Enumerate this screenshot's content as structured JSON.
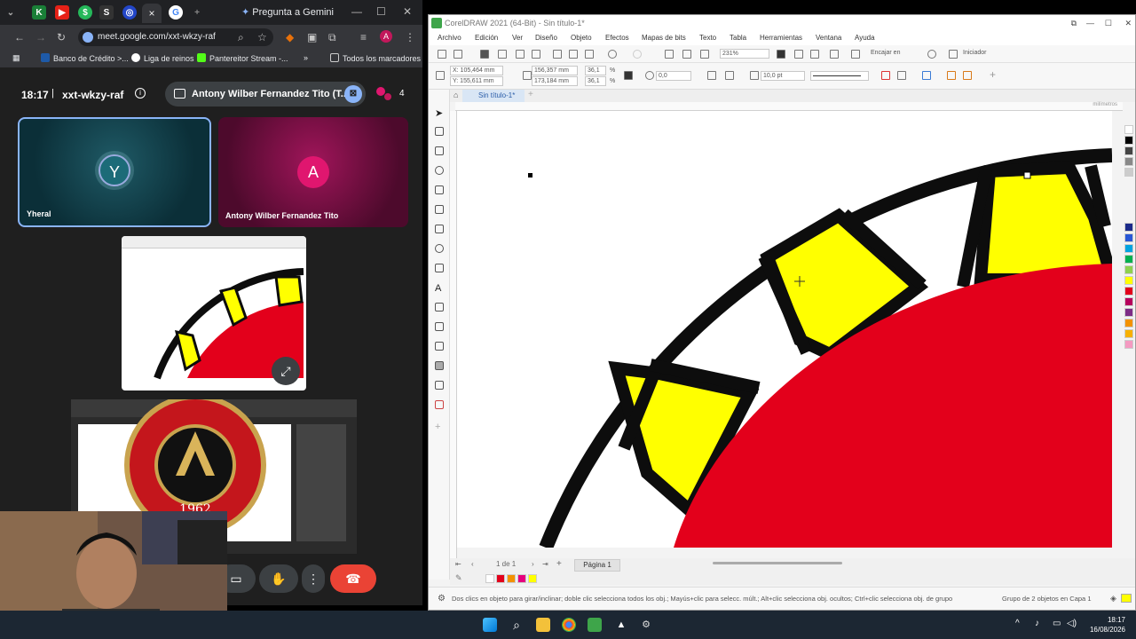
{
  "chrome": {
    "gemini_tab_title": "Pregunta a Gemini",
    "url": "meet.google.com/xxt-wkzy-raf",
    "bookmarks": [
      "Banco de Crédito >...",
      "Liga de reinos",
      "Pantereitor Stream -...",
      "»",
      "Todos los marcadores"
    ]
  },
  "meet": {
    "time": "18:17",
    "code": "xxt-wkzy-raf",
    "presenter_banner": "Antony Wilber Fernandez Tito (T...",
    "participant_count": "4",
    "tiles": [
      {
        "initial": "Y",
        "name": "Yheral",
        "color": "#1f5a66"
      },
      {
        "initial": "A",
        "name": "Antony Wilber Fernandez Tito",
        "color": "#e0166f"
      }
    ],
    "logo_text": "COLEGIO DE ... S DEL PERU",
    "logo_year": "1962"
  },
  "corel": {
    "title": "CorelDRAW 2021 (64-Bit) - Sin título-1*",
    "menu": [
      "Archivo",
      "Edición",
      "Ver",
      "Diseño",
      "Objeto",
      "Efectos",
      "Mapas de bits",
      "Texto",
      "Tabla",
      "Herramientas",
      "Ventana",
      "Ayuda"
    ],
    "zoom": "231%",
    "snap_label": "Encajar en",
    "launcher_label": "Iniciador",
    "x_pos": "X: 105,464 mm",
    "y_pos": "Y: 155,611 mm",
    "width": "156,357 mm",
    "height": "173,184 mm",
    "scale_x": "36,1",
    "scale_y": "36,1",
    "percent": "%",
    "rotation": "0,0",
    "outline": "10,0 pt",
    "doc_tab": "Sin título-1*",
    "ruler_unit": "milímetros",
    "page_count": "1 de 1",
    "page_tab": "Página 1",
    "status_hint": "Dos clics en objeto para girar/inclinar; doble clic selecciona todos los obj.; Mayús+clic para selecc. múlt.; Alt+clic selecciona obj. ocultos; Ctrl+clic selecciona obj. de grupo",
    "status_sel": "Grupo de 2 objetos en Capa 1"
  },
  "taskbar": {
    "time": "18:17",
    "date": "16/08/2026"
  },
  "colors": {
    "red": "#e3001b",
    "yellow": "#ffff00",
    "black": "#0d0d0d"
  }
}
